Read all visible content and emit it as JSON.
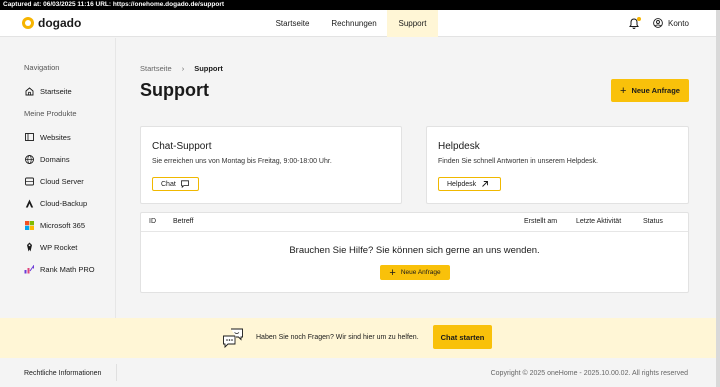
{
  "capture_bar": {
    "text": "Captured at: 06/03/2025 11:16   URL: https://onehome.dogado.de/support"
  },
  "brand": {
    "name": "dogado",
    "accent_color": "#f9c10a",
    "highlight_bg": "#fff6d6"
  },
  "topnav": {
    "tabs": [
      {
        "label": "Startseite",
        "active": false
      },
      {
        "label": "Rechnungen",
        "active": false
      },
      {
        "label": "Support",
        "active": true
      }
    ],
    "bell_icon": "bell-icon",
    "account_label": "Konto"
  },
  "sidebar": {
    "navigation_heading": "Navigation",
    "home_label": "Startseite",
    "products_heading": "Meine Produkte",
    "products": [
      {
        "label": "Websites",
        "icon": "browser-window-icon"
      },
      {
        "label": "Domains",
        "icon": "globe-icon"
      },
      {
        "label": "Cloud Server",
        "icon": "server-icon"
      },
      {
        "label": "Cloud-Backup",
        "icon": "backup-a-icon"
      },
      {
        "label": "Microsoft 365",
        "icon": "microsoft-logo-icon"
      },
      {
        "label": "WP Rocket",
        "icon": "rocket-icon"
      },
      {
        "label": "Rank Math PRO",
        "icon": "rank-math-icon"
      }
    ]
  },
  "breadcrumb": {
    "home": "Startseite",
    "separator": "›",
    "current": "Support"
  },
  "page": {
    "title": "Support",
    "new_request_label": "Neue Anfrage"
  },
  "chat_card": {
    "title": "Chat-Support",
    "text": "Sie erreichen uns von Montag bis Freitag, 9:00-18:00 Uhr.",
    "button_label": "Chat"
  },
  "helpdesk_card": {
    "title": "Helpdesk",
    "text": "Finden Sie schnell Antworten in unserem Helpdesk.",
    "button_label": "Helpdesk"
  },
  "tickets_table": {
    "columns": [
      "ID",
      "Betreff",
      "Erstellt am",
      "Letzte Aktivität",
      "Status"
    ],
    "empty_message": "Brauchen Sie Hilfe? Sie können sich gerne an uns wenden.",
    "empty_button_label": "Neue Anfrage"
  },
  "help_band": {
    "text": "Haben Sie noch Fragen? Wir sind hier um zu helfen.",
    "button_label": "Chat starten"
  },
  "footer": {
    "legal_label": "Rechtliche Informationen",
    "copyright": "Copyright © 2025 oneHome - 2025.10.00.02. All rights reserved"
  }
}
